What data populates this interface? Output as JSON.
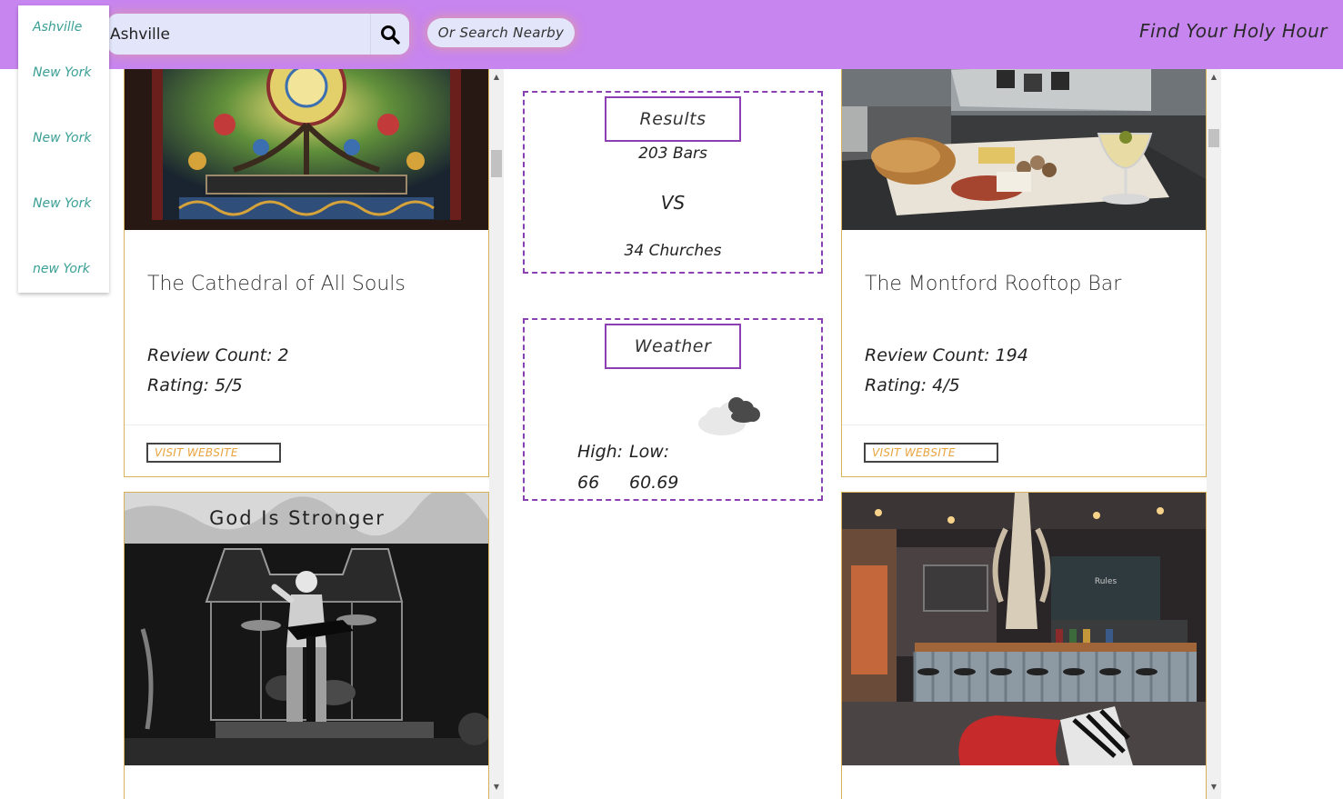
{
  "header": {
    "search_value": "Ashville",
    "search_icon": "search-icon",
    "nearby_label": "Or Search Nearby",
    "tagline": "Find Your Holy Hour",
    "background": "#c785ef"
  },
  "dropdown": {
    "items": [
      "Ashville",
      "New York",
      "New York",
      "New York",
      "new York"
    ],
    "color": "#3a9f94"
  },
  "churches": {
    "cards": [
      {
        "image_caption": "",
        "title": "The Cathedral of All Souls",
        "review_count": "Review Count: 2",
        "rating": "Rating: 5/5",
        "visit_label": "VISIT WEBSITE"
      },
      {
        "image_caption": "God Is Stronger"
      }
    ]
  },
  "bars": {
    "cards": [
      {
        "title": "The Montford Rooftop Bar",
        "review_count": "Review Count: 194",
        "rating": "Rating: 4/5",
        "visit_label": "VISIT WEBSITE"
      },
      {
        "title": ""
      }
    ]
  },
  "results": {
    "header": "Results",
    "bars": "203 Bars",
    "vs": "VS",
    "churches": "34 Churches"
  },
  "weather": {
    "header": "Weather",
    "icon": "cloudy-icon",
    "high_label": "High:",
    "low_label": "Low:",
    "high_value": "66",
    "low_value": "60.69"
  },
  "colors": {
    "accent_purple": "#8a3fb3",
    "card_border": "#d6b25a",
    "visit_text": "#e8a33c"
  }
}
